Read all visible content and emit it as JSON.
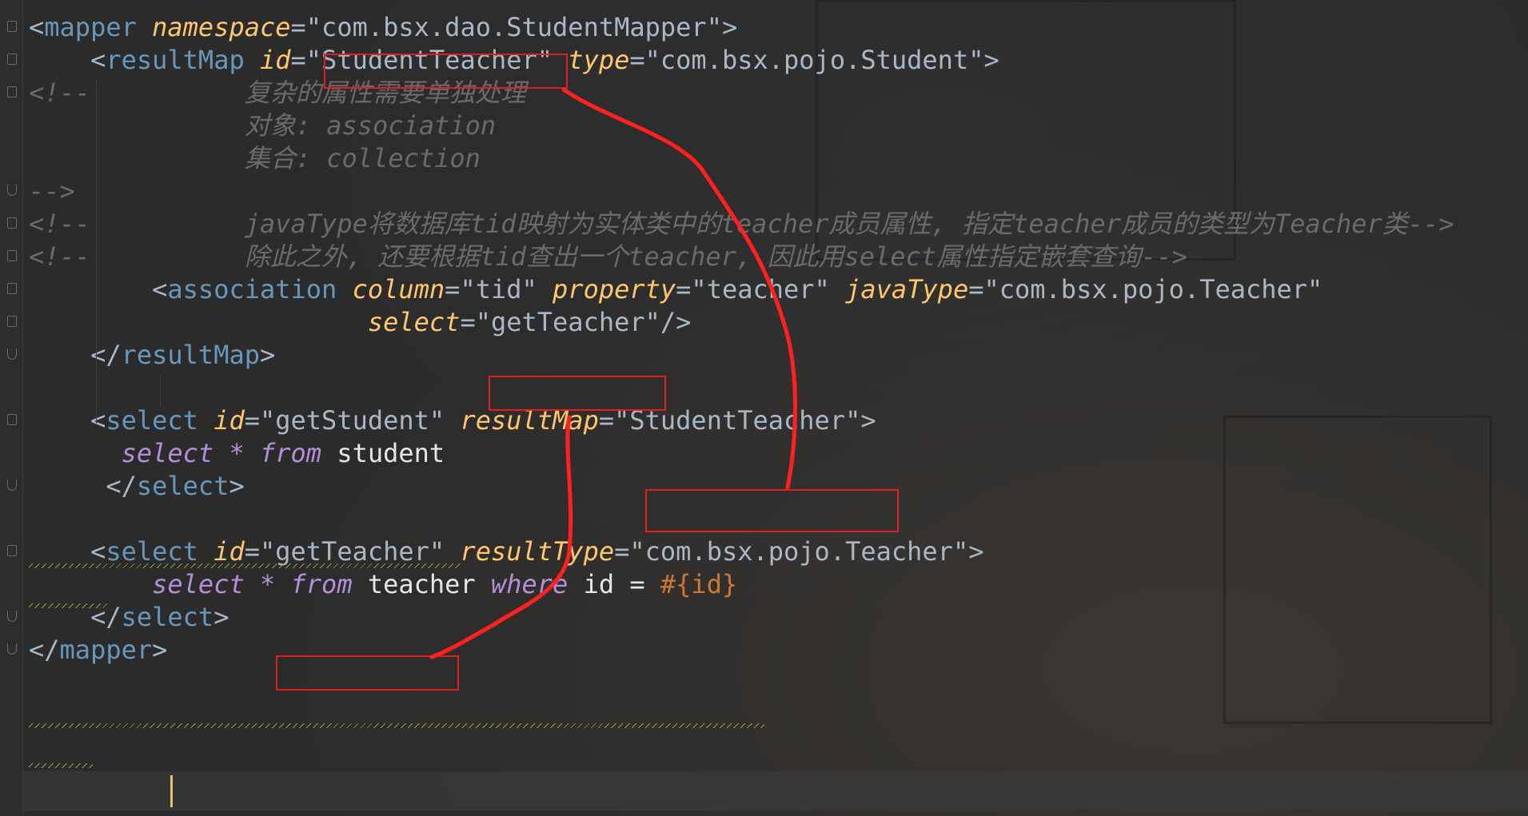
{
  "lines": [
    {
      "prefix": "",
      "tokens": [
        {
          "c": "bracket-open",
          "t": "<"
        },
        {
          "c": "tagname",
          "t": "mapper"
        },
        {
          "c": "sp",
          "t": " "
        },
        {
          "c": "attr",
          "t": "namespace"
        },
        {
          "c": "bracket",
          "t": "="
        },
        {
          "c": "str",
          "t": "\"com.bsx.dao.StudentMapper\""
        },
        {
          "c": "bracket",
          "t": ">"
        }
      ]
    },
    {
      "prefix": "    ",
      "tokens": [
        {
          "c": "bracket",
          "t": "<"
        },
        {
          "c": "tagname",
          "t": "resultMap"
        },
        {
          "c": "sp",
          "t": " "
        },
        {
          "c": "attr",
          "t": "id"
        },
        {
          "c": "bracket",
          "t": "="
        },
        {
          "c": "str",
          "t": "\"StudentTeacher\""
        },
        {
          "c": "sp",
          "t": " "
        },
        {
          "c": "attr",
          "t": "type"
        },
        {
          "c": "bracket",
          "t": "="
        },
        {
          "c": "str",
          "t": "\"com.bsx.pojo.Student\""
        },
        {
          "c": "bracket",
          "t": ">"
        }
      ]
    },
    {
      "prefix": "",
      "tokens": [
        {
          "c": "cm",
          "t": "<!--          复杂的属性需要单独处理"
        }
      ]
    },
    {
      "prefix": "",
      "tokens": [
        {
          "c": "cm",
          "t": "              对象: association"
        }
      ]
    },
    {
      "prefix": "",
      "tokens": [
        {
          "c": "cm",
          "t": "              集合: collection"
        }
      ]
    },
    {
      "prefix": "",
      "tokens": [
        {
          "c": "cm",
          "t": "-->"
        }
      ]
    },
    {
      "prefix": "",
      "tokens": [
        {
          "c": "cm",
          "t": "<!--          javaType将数据库tid映射为实体类中的teacher成员属性, 指定teacher成员的类型为Teacher类-->"
        }
      ]
    },
    {
      "prefix": "",
      "tokens": [
        {
          "c": "cm",
          "t": "<!--          除此之外, 还要根据tid查出一个teacher, 因此用select属性指定嵌套查询-->"
        }
      ]
    },
    {
      "prefix": "        ",
      "tokens": [
        {
          "c": "bracket",
          "t": "<"
        },
        {
          "c": "tagname",
          "t": "association"
        },
        {
          "c": "sp",
          "t": " "
        },
        {
          "c": "attr",
          "t": "column"
        },
        {
          "c": "bracket",
          "t": "="
        },
        {
          "c": "str",
          "t": "\"tid\""
        },
        {
          "c": "sp",
          "t": " "
        },
        {
          "c": "attr",
          "t": "property"
        },
        {
          "c": "bracket",
          "t": "="
        },
        {
          "c": "str",
          "t": "\"teacher\""
        },
        {
          "c": "sp",
          "t": " "
        },
        {
          "c": "attr",
          "t": "javaType"
        },
        {
          "c": "bracket",
          "t": "="
        },
        {
          "c": "str",
          "t": "\"com.bsx.pojo.Teacher\""
        }
      ]
    },
    {
      "prefix": "                      ",
      "tokens": [
        {
          "c": "attr",
          "t": "select"
        },
        {
          "c": "bracket",
          "t": "="
        },
        {
          "c": "str",
          "t": "\"getTeacher\""
        },
        {
          "c": "bracket",
          "t": "/>"
        }
      ]
    },
    {
      "prefix": "    ",
      "tokens": [
        {
          "c": "bracket",
          "t": "</"
        },
        {
          "c": "tagname",
          "t": "resultMap"
        },
        {
          "c": "bracket",
          "t": ">"
        }
      ]
    },
    {
      "prefix": "",
      "tokens": []
    },
    {
      "prefix": "    ",
      "tokens": [
        {
          "c": "bracket",
          "t": "<"
        },
        {
          "c": "tagname",
          "t": "select"
        },
        {
          "c": "sp",
          "t": " "
        },
        {
          "c": "attr",
          "t": "id"
        },
        {
          "c": "bracket",
          "t": "="
        },
        {
          "c": "str",
          "t": "\"getStudent\""
        },
        {
          "c": "sp",
          "t": " "
        },
        {
          "c": "attr",
          "t": "resultMap"
        },
        {
          "c": "bracket",
          "t": "="
        },
        {
          "c": "str",
          "t": "\"StudentTeacher\""
        },
        {
          "c": "bracket",
          "t": ">"
        }
      ]
    },
    {
      "prefix": "      ",
      "tokens": [
        {
          "c": "kw",
          "t": "select"
        },
        {
          "c": "sp",
          "t": " "
        },
        {
          "c": "kw",
          "t": "*"
        },
        {
          "c": "sp",
          "t": " "
        },
        {
          "c": "kw",
          "t": "from"
        },
        {
          "c": "sp",
          "t": " "
        },
        {
          "c": "plain",
          "t": "student"
        }
      ]
    },
    {
      "prefix": "     ",
      "tokens": [
        {
          "c": "bracket",
          "t": "</"
        },
        {
          "c": "tagname",
          "t": "select"
        },
        {
          "c": "bracket",
          "t": ">"
        }
      ]
    },
    {
      "prefix": "",
      "tokens": []
    },
    {
      "prefix": "    ",
      "tokens": [
        {
          "c": "bracket",
          "t": "<"
        },
        {
          "c": "tagname",
          "t": "select"
        },
        {
          "c": "sp",
          "t": " "
        },
        {
          "c": "attr",
          "t": "id"
        },
        {
          "c": "bracket",
          "t": "="
        },
        {
          "c": "str",
          "t": "\"getTeacher\""
        },
        {
          "c": "sp",
          "t": " "
        },
        {
          "c": "attr",
          "t": "resultType"
        },
        {
          "c": "bracket",
          "t": "="
        },
        {
          "c": "str",
          "t": "\"com.bsx.pojo.Teacher\""
        },
        {
          "c": "bracket",
          "t": ">"
        }
      ]
    },
    {
      "prefix": "        ",
      "tokens": [
        {
          "c": "kw",
          "t": "select"
        },
        {
          "c": "sp",
          "t": " "
        },
        {
          "c": "kw",
          "t": "*"
        },
        {
          "c": "sp",
          "t": " "
        },
        {
          "c": "kw",
          "t": "from"
        },
        {
          "c": "sp",
          "t": " "
        },
        {
          "c": "plain",
          "t": "teacher"
        },
        {
          "c": "sp",
          "t": " "
        },
        {
          "c": "kw",
          "t": "where"
        },
        {
          "c": "sp",
          "t": " "
        },
        {
          "c": "plain",
          "t": "id"
        },
        {
          "c": "sp",
          "t": " "
        },
        {
          "c": "plain",
          "t": "="
        },
        {
          "c": "sp",
          "t": " "
        },
        {
          "c": "ph",
          "t": "#{id}"
        }
      ]
    },
    {
      "prefix": "    ",
      "tokens": [
        {
          "c": "bracket",
          "t": "</"
        },
        {
          "c": "tagname",
          "t": "select"
        },
        {
          "c": "bracket",
          "t": ">"
        }
      ]
    },
    {
      "prefix": "",
      "tokens": [
        {
          "c": "bracket",
          "t": "</"
        },
        {
          "c": "tagname",
          "t": "mapper"
        },
        {
          "c": "bracket",
          "t": ">"
        }
      ]
    }
  ],
  "annotations": {
    "highlight_color": "#e02020",
    "boxed_values": [
      "\"StudentTeacher\"",
      "\"getTeacher\"",
      "\"StudentTeacher\"",
      "\"getTeacher\""
    ]
  },
  "colors": {
    "background": "#2b2b2b",
    "tag_name": "#6897bb",
    "attribute": "#ffc66d",
    "comment": "#6a6a6a",
    "sql_keyword": "#b48ed8"
  }
}
